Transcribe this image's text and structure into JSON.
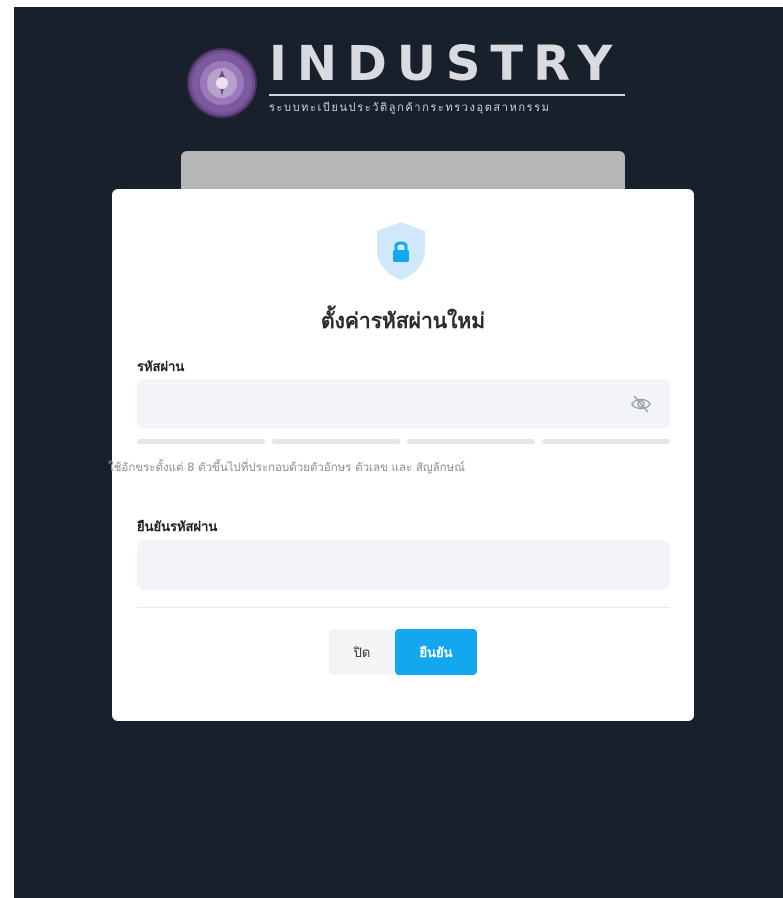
{
  "brand": {
    "name": "INDUSTRY",
    "subtitle": "ระบบทะเบียนประวัติลูกค้ากระทรวงอุตสาหกรรม"
  },
  "modal": {
    "title": "ตั้งค่ารหัสผ่านใหม่",
    "password_label": "รหัสผ่าน",
    "password_value": "",
    "password_hint": "ใช้อักขระตั้งแต่ 8 ตัวขึ้นไปที่ประกอบด้วยตัวอักษร ตัวเลข และ สัญลักษณ์",
    "confirm_label": "ยืนยันรหัสผ่าน",
    "confirm_value": "",
    "strength_segments": 4,
    "close_button": "ปิด",
    "confirm_button": "ยืนยัน"
  },
  "colors": {
    "backdrop": "#18202c",
    "accent": "#12a7ee",
    "shield": "#cfe9fb",
    "input_bg": "#f2f4f8"
  },
  "icons": {
    "shield": "shield-lock-icon",
    "password_toggle": "eye-off-icon",
    "logo": "ministry-seal-icon"
  }
}
